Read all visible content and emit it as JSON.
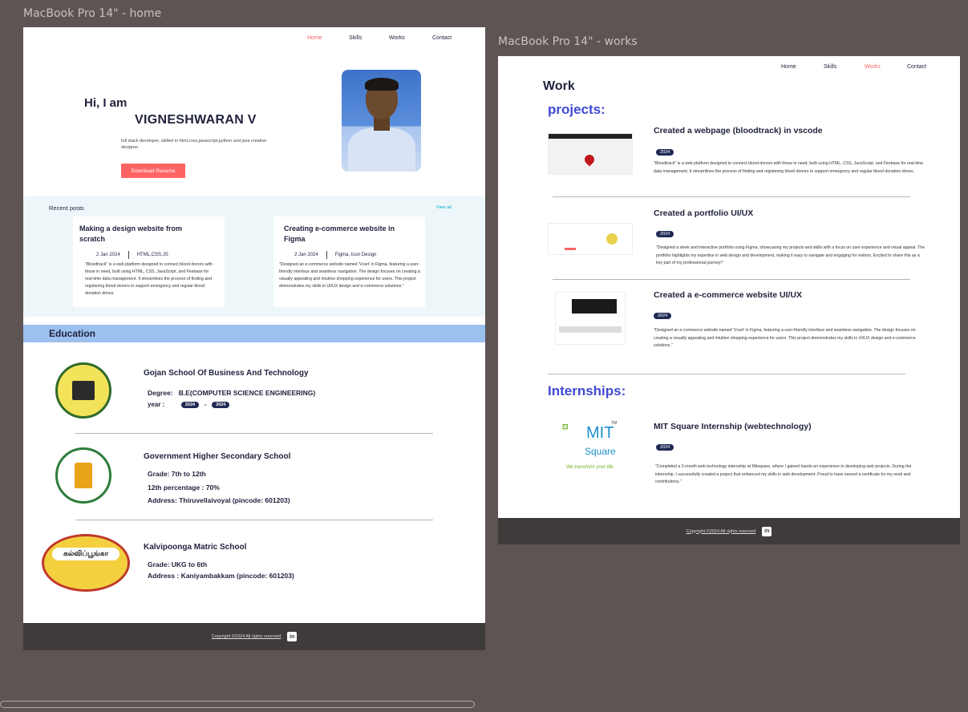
{
  "home": {
    "frame_label": "MacBook Pro 14\" - home",
    "nav": [
      "Home",
      "Skills",
      "Works",
      "Contact"
    ],
    "hero": {
      "greeting": "Hi, I am",
      "name": "VIGNESHWARAN V",
      "description": "full stack developer, skilled in html,csss,javascript,python and java creative designer.",
      "button": "Download Resume"
    },
    "posts": {
      "title": "Recent posts",
      "view_all": "View all",
      "items": [
        {
          "title": "Making a design website  from scratch",
          "date": "2 Jan 2024",
          "tags": "HTML,CSS,JS",
          "text": "\"Bloodtrack\" is a web platform designed to connect blood donors with those in need, built using HTML, CSS, JavaScript, and Firebase for real-time data management. It streamlines the process of finding and registering blood donors to support emergency and regular blood donation drives."
        },
        {
          "title": "Creating e-commerce website in Figma",
          "date": "2 Jan 2024",
          "tags": "Figma, Icon Design",
          "text": "\"Designed an e-commerce website named 'Vcart' in Figma, featuring a user-friendly interface and seamless navigation. The design focuses on creating a visually appealing and intuitive shopping experience for users. This project demonstrates my skills in UI/UX design and e-commerce solutions.\""
        }
      ]
    },
    "education": {
      "title": "Education",
      "schools": [
        {
          "name": "Gojan School Of Business And Technology",
          "degree_label": "Degree:",
          "degree": "B.E(COMPUTER SCIENCE ENGINEERING)",
          "year_label": "year :",
          "year_from": "2024",
          "dash": "-",
          "year_to": "2024"
        },
        {
          "name": "Government Higher Secondary School",
          "grade": "Grade:  7th  to  12th",
          "percentage": "12th percentage :  70%",
          "address": "Address: Thiruvellaivoyal (pincode: 601203)"
        },
        {
          "name": "Kalvipoonga Matric School",
          "grade": "Grade:  UKG  to  6th",
          "address": "Address :  Kaniyambakkam (pincode: 601203)",
          "logo_text": "கல்விப்பூங்கா"
        }
      ]
    },
    "footer": {
      "text": "Copyright ©2024 All rights reserved",
      "icon": "in"
    }
  },
  "works": {
    "frame_label": "MacBook Pro 14\" - works",
    "nav": [
      "Home",
      "Skills",
      "Works",
      "Contact"
    ],
    "title": "Work",
    "projects_heading": "projects:",
    "projects": [
      {
        "title": "Created a webpage (bloodtrack) in vscode",
        "year": "2024",
        "text": "\"Bloodtrack\" is a web platform designed to connect blood donors with those in need, built using HTML, CSS, JavaScript, and Firebase for real-time data management. It streamlines the process of finding and registering blood donors to support emergency and regular blood donation drives."
      },
      {
        "title": "Created a  portfolio   UI/UX",
        "year": "2024",
        "text": "\"Designed a sleek and interactive portfolio using Figma, showcasing my projects and skills with a focus on user experience and visual appeal. The portfolio highlights my expertise in web design and development, making it easy to navigate and engaging for visitors. Excited to share this as a key part of my professional journey!\""
      },
      {
        "title": "Created a  e-commerce website   UI/UX",
        "year": "2024",
        "text": "\"Designed an e-commerce website named 'Vcart' in Figma, featuring a user-friendly interface and seamless navigation. The design focuses on creating a visually appealing and intuitive shopping experience for users. This project demonstrates my skills in UI/UX design and e-commerce solutions.\""
      }
    ],
    "internships_heading": "Internships:",
    "internship": {
      "title": "MIT Square Internship (webtechnology)",
      "year": "2024",
      "text": "\"Completed a 2-month web technology internship at Mitsquare, where I gained hands-on experience in developing web projects. During the internship, I successfully created a project that enhanced my skills in web development. Proud to have earned a certificate for my work and contributions.\"",
      "logo_main": "MIT",
      "logo_sub": "Square",
      "logo_tm": "TM",
      "logo_tagline": "We transform your life"
    },
    "footer": {
      "text": "Copyright ©2024 All rights reserved",
      "icon": "in"
    }
  },
  "colors": {
    "accent": "#ff6464",
    "dark": "#21243d",
    "section_blue": "#3e4ad1",
    "footer": "#3e3b3a",
    "pill": "#1f2a55"
  }
}
